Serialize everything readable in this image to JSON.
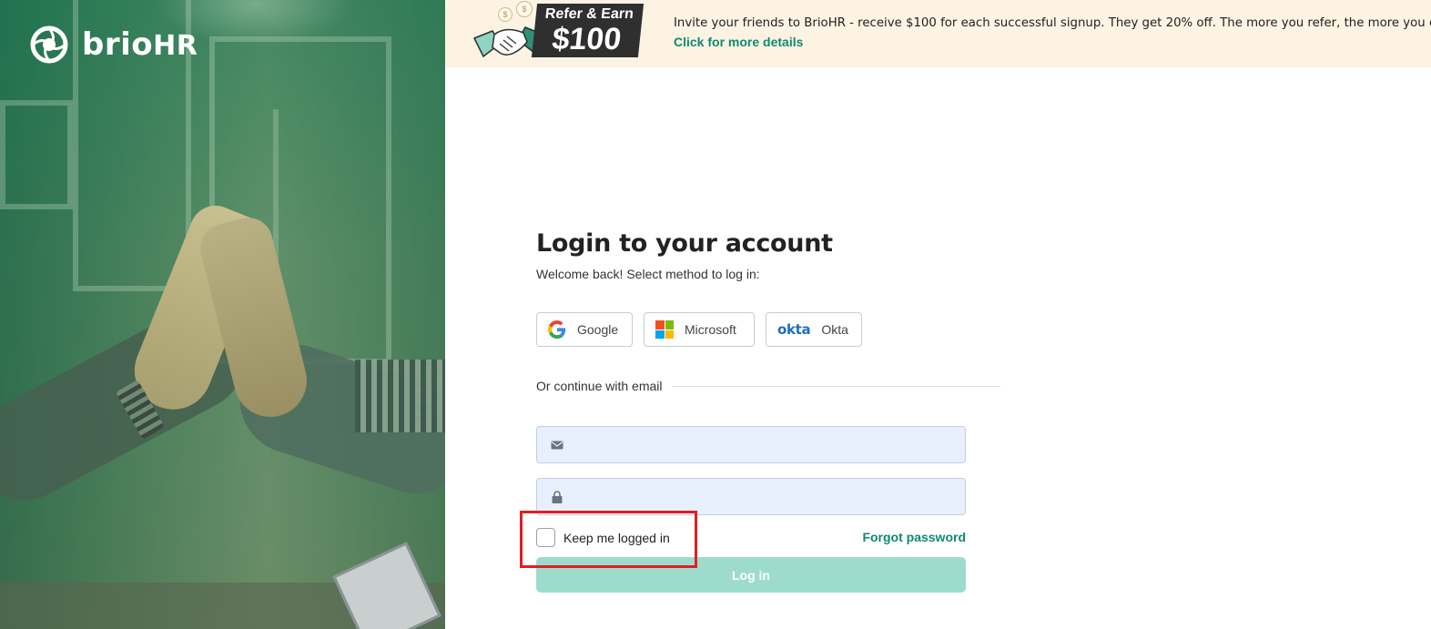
{
  "brand": {
    "name": "brio",
    "name_suffix": "HR",
    "primary_color": "#0f8a72",
    "accent_color": "#9ddccd"
  },
  "banner": {
    "badge_top": "Refer & Earn",
    "badge_amount": "$100",
    "coin_symbol": "$",
    "message": "Invite your friends to BrioHR - receive $100 for each successful signup. They get 20% off. The more you refer, the more you earn",
    "link_text": "Click for more details",
    "background": "#fdf3e3"
  },
  "login": {
    "title": "Login to your account",
    "subtitle": "Welcome back! Select method to log in:",
    "sso": [
      {
        "id": "google",
        "label": "Google",
        "icon": "google-icon"
      },
      {
        "id": "microsoft",
        "label": "Microsoft",
        "icon": "microsoft-icon"
      },
      {
        "id": "okta",
        "label": "Okta",
        "icon": "okta-icon",
        "icon_text": "okta"
      }
    ],
    "divider_label": "Or continue with email",
    "email": {
      "value": "",
      "placeholder": "",
      "icon": "envelope-icon"
    },
    "password": {
      "value": "",
      "placeholder": "",
      "icon": "lock-icon"
    },
    "keep_logged_in": {
      "label": "Keep me logged in",
      "checked": false,
      "highlight_color": "#e01e26"
    },
    "forgot_password": "Forgot password",
    "submit_label": "Log in"
  }
}
